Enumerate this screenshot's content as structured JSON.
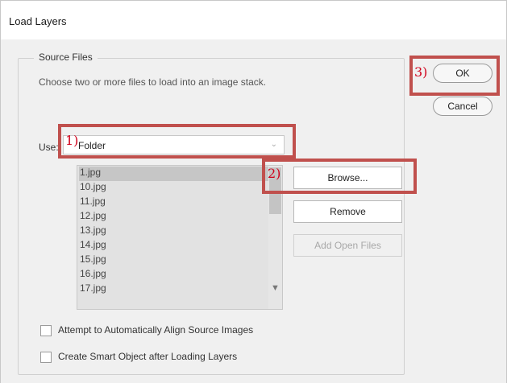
{
  "window": {
    "title": "Load Layers"
  },
  "source_files": {
    "legend": "Source Files",
    "description": "Choose two or more files to load into an image stack.",
    "use_label": "Use:",
    "use_value": "Folder",
    "files": [
      "1.jpg",
      "10.jpg",
      "11.jpg",
      "12.jpg",
      "13.jpg",
      "14.jpg",
      "15.jpg",
      "16.jpg",
      "17.jpg"
    ],
    "buttons": {
      "browse": "Browse...",
      "remove": "Remove",
      "add_open_files": "Add Open Files"
    }
  },
  "options": {
    "align": "Attempt to Automatically Align Source Images",
    "smart_object": "Create Smart Object after Loading Layers"
  },
  "actions": {
    "ok": "OK",
    "cancel": "Cancel"
  },
  "annotations": {
    "one": "1)",
    "two": "2)",
    "three": "3)",
    "color": "#c0504d"
  }
}
